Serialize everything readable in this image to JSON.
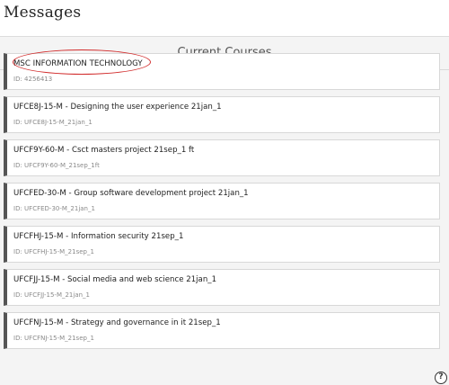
{
  "header": {
    "title": "Messages"
  },
  "main": {
    "section_title": "Current Courses",
    "courses": [
      {
        "name": "MSC INFORMATION TECHNOLOGY",
        "id": "ID: 4256413"
      },
      {
        "name": "UFCE8J-15-M - Designing the user experience 21jan_1",
        "id": "ID: UFCE8J-15-M_21jan_1"
      },
      {
        "name": "UFCF9Y-60-M - Csct masters project 21sep_1 ft",
        "id": "ID: UFCF9Y-60-M_21sep_1ft"
      },
      {
        "name": "UFCFED-30-M - Group software development project 21jan_1",
        "id": "ID: UFCFED-30-M_21jan_1"
      },
      {
        "name": "UFCFHJ-15-M - Information security 21sep_1",
        "id": "ID: UFCFHJ-15-M_21sep_1"
      },
      {
        "name": "UFCFJJ-15-M - Social media and web science 21jan_1",
        "id": "ID: UFCFJJ-15-M_21jan_1"
      },
      {
        "name": "UFCFNJ-15-M - Strategy and governance in it 21sep_1",
        "id": "ID: UFCFNJ-15-M_21sep_1"
      }
    ]
  },
  "help": {
    "icon": "help-icon",
    "glyph": "?"
  },
  "colors": {
    "card_accent": "#555555",
    "highlight": "#d12b2b",
    "background": "#f4f4f4"
  }
}
